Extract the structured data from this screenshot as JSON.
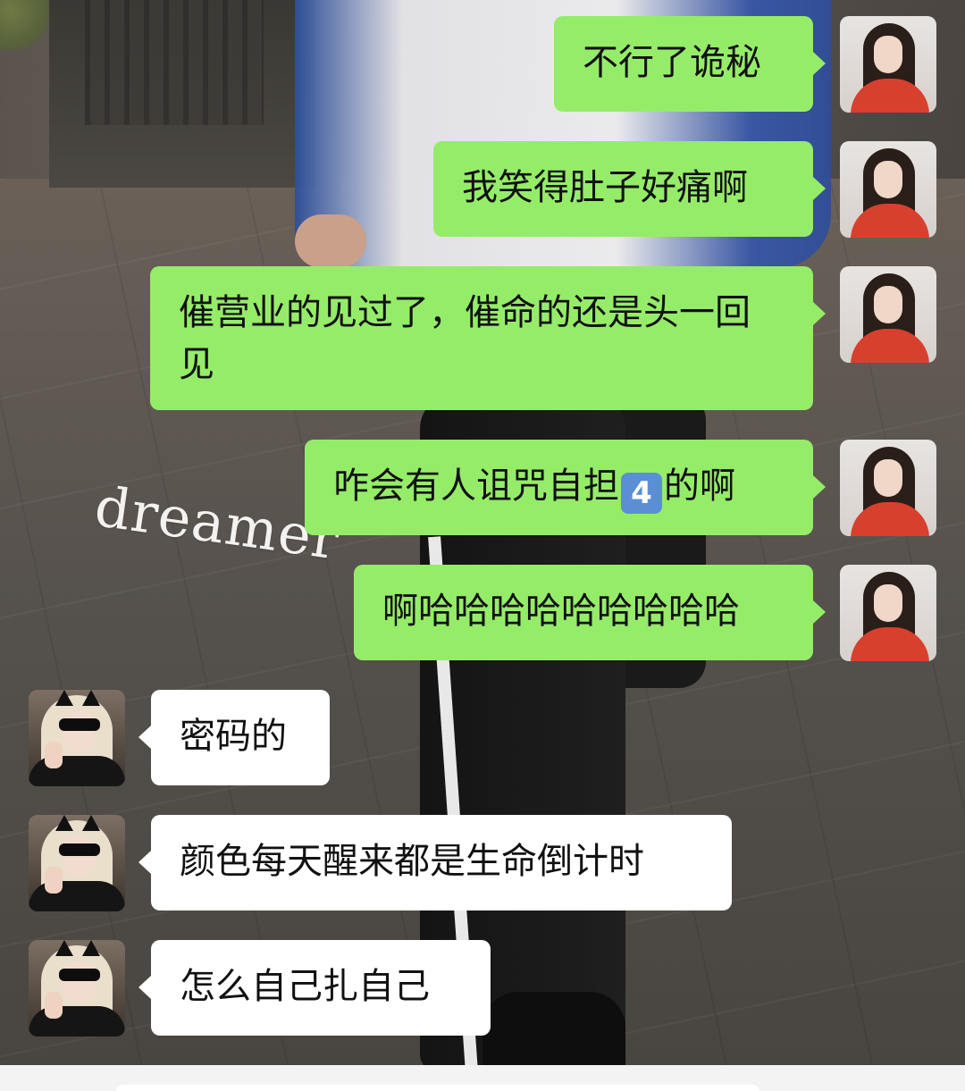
{
  "chat": {
    "watermark": "dreamer",
    "messages": [
      {
        "side": "self",
        "text": "不行了诡秘"
      },
      {
        "side": "self",
        "text": "我笑得肚子好痛啊"
      },
      {
        "side": "self",
        "text": "催营业的见过了，催命的还是头一回见"
      },
      {
        "side": "self",
        "text_before": "咋会有人诅咒自担",
        "emoji": "4",
        "text_after": "的啊"
      },
      {
        "side": "self",
        "text": "啊哈哈哈哈哈哈哈哈哈"
      },
      {
        "side": "other",
        "text": "密码的"
      },
      {
        "side": "other",
        "text": "颜色每天醒来都是生命倒计时"
      },
      {
        "side": "other",
        "text": "怎么自己扎自己"
      }
    ]
  },
  "colors": {
    "self_bubble": "#95ec69",
    "other_bubble": "#ffffff"
  }
}
